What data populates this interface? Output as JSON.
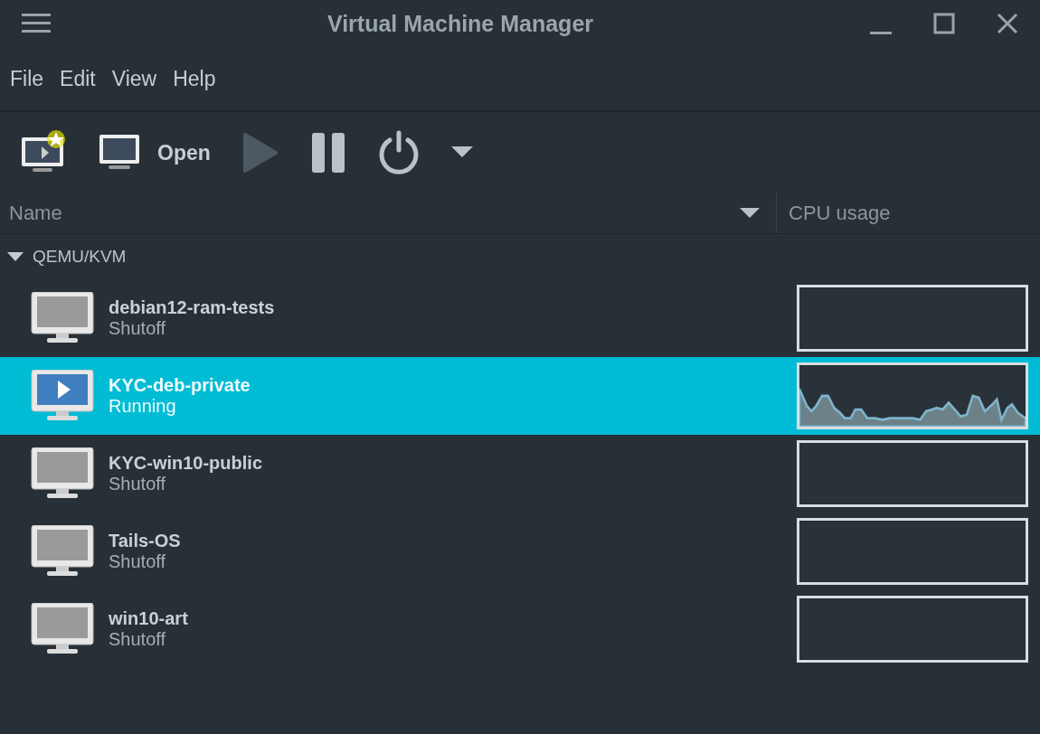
{
  "window": {
    "title": "Virtual Machine Manager"
  },
  "menu": [
    {
      "label": "File"
    },
    {
      "label": "Edit"
    },
    {
      "label": "View"
    },
    {
      "label": "Help"
    }
  ],
  "toolbar": [
    {
      "kind": "new"
    },
    {
      "kind": "open",
      "label": "Open"
    },
    {
      "kind": "run",
      "disabled": true
    },
    {
      "kind": "pause",
      "disabled": false
    },
    {
      "kind": "shutdown",
      "disabled": false
    },
    {
      "kind": "dropdown"
    }
  ],
  "columns": [
    {
      "label": "Name"
    },
    {
      "label": "CPU usage"
    }
  ],
  "group": {
    "label": "QEMU/KVM",
    "expanded": true
  },
  "vms": [
    {
      "name": "debian12-ram-tests",
      "status": "Shutoff",
      "kind": "shutoff",
      "selected": false
    },
    {
      "name": "KYC-deb-private",
      "status": "Running",
      "kind": "running",
      "selected": true
    },
    {
      "name": "KYC-win10-public",
      "status": "Shutoff",
      "kind": "shutoff",
      "selected": false
    },
    {
      "name": "Tails-OS",
      "status": "Shutoff",
      "kind": "shutoff",
      "selected": false
    },
    {
      "name": "win10-art",
      "status": "Shutoff",
      "kind": "shutoff",
      "selected": false
    }
  ]
}
